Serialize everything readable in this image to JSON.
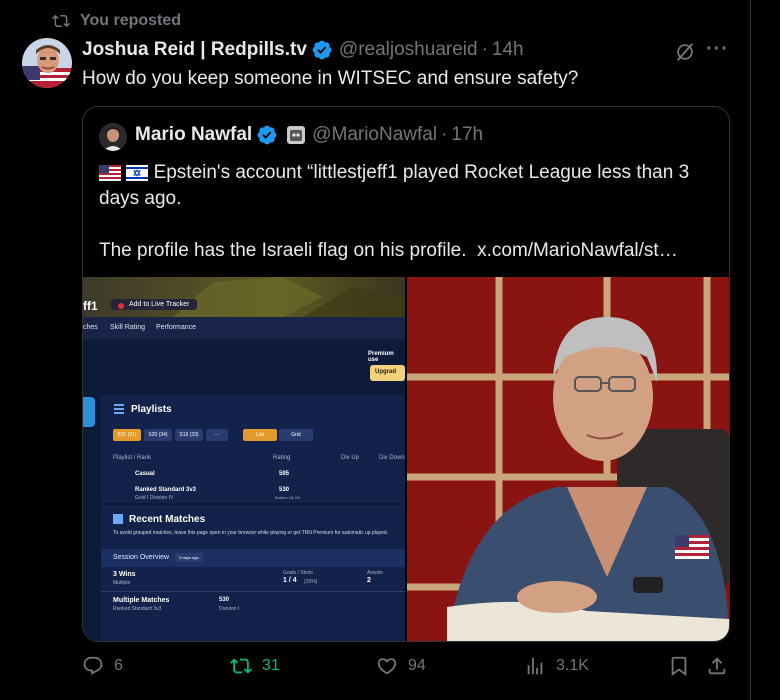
{
  "repost": {
    "label": "You reposted"
  },
  "tweet": {
    "author_name": "Joshua Reid | Redpills.tv",
    "handle": "@realjoshuareid",
    "separator": "·",
    "time": "14h",
    "text": "How do you keep someone in WITSEC and ensure safety?"
  },
  "quote": {
    "author_name": "Mario Nawfal",
    "handle": "@MarioNawfal",
    "separator": "·",
    "time": "17h",
    "line1": "Epstein's account “littlestjeff1 played Rocket League less than 3 days ago.",
    "line2": "The profile has the Israeli flag on his profile.",
    "link": "x.com/MarioNawfal/st…"
  },
  "screenshot": {
    "title_fragment": "ff1",
    "add_button": "Add to Live Tracker",
    "nav": [
      "ches",
      "Skill Rating",
      "Performance"
    ],
    "premium": "Premium use",
    "upgrade": "Upgrad",
    "playlists_title": "Playlists",
    "season_pills": [
      "S31 (31)",
      "S20 (34)",
      "S19 (33)",
      "···"
    ],
    "view_pills": [
      "List",
      "Grid"
    ],
    "columns": [
      "Playlist / Rank",
      "Rating",
      "Div Up",
      "Div Down"
    ],
    "rows": [
      {
        "name": "Casual",
        "sub": "",
        "rating": "595",
        "rating_sub": ""
      },
      {
        "name": "Ranked Standard 3v3",
        "sub": "Gold I Division IV",
        "rating": "530",
        "rating_sub": "Bottom 18.2%"
      }
    ],
    "recent_title": "Recent Matches",
    "recent_desc": "To avoid grouped matches, leave this page open in your browser while playing or get TRN Premium for automatic up played.",
    "session_label": "Session Overview",
    "session_ago": "5 days ago",
    "wins": "3 Wins",
    "wins_sub": "Multiple",
    "goals_label": "Goals / Shots",
    "goals_value": "1 / 4",
    "goals_pct": "(25%)",
    "assists_label": "Assists",
    "assists_value": "2",
    "multi_label": "Multiple Matches",
    "multi_sub": "Ranked Standard 3v3",
    "multi_rating": "530",
    "multi_div": "Division I"
  },
  "actions": {
    "replies": "6",
    "reposts": "31",
    "likes": "94",
    "views": "3.1K"
  },
  "colors": {
    "verified": "#1d9bf0",
    "retweet": "#00ba7c",
    "muted": "#71767b",
    "border": "#2f3336"
  }
}
